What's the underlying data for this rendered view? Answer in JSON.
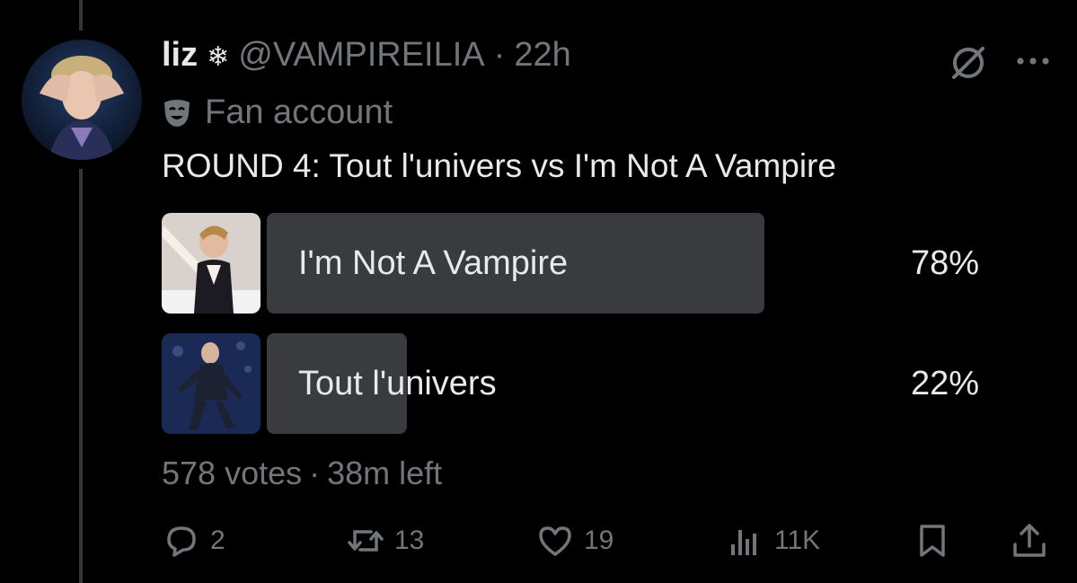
{
  "tweet": {
    "author_name": "liz",
    "author_badge": "❄",
    "handle": "@VAMPIREILIA",
    "separator": "·",
    "time": "22h",
    "label": "Fan account",
    "text": "ROUND 4: Tout l'univers vs I'm Not A Vampire"
  },
  "poll": {
    "options": [
      {
        "label": "I'm Not A Vampire",
        "percent_text": "78%",
        "fraction": 0.78
      },
      {
        "label": "Tout l'univers",
        "percent_text": "22%",
        "fraction": 0.22
      }
    ],
    "votes": "578 votes",
    "separator": "·",
    "time_left": "38m left"
  },
  "actions": {
    "replies": "2",
    "reposts": "13",
    "likes": "19",
    "views": "11K"
  },
  "colors": {
    "background": "#000000",
    "text": "#e7e9ea",
    "secondary": "#71767b",
    "poll_bar": "#3a3b3f"
  },
  "icons": [
    "grok-icon",
    "more-icon",
    "mask-icon",
    "reply-icon",
    "repost-icon",
    "like-icon",
    "views-icon",
    "bookmark-icon",
    "share-icon"
  ]
}
